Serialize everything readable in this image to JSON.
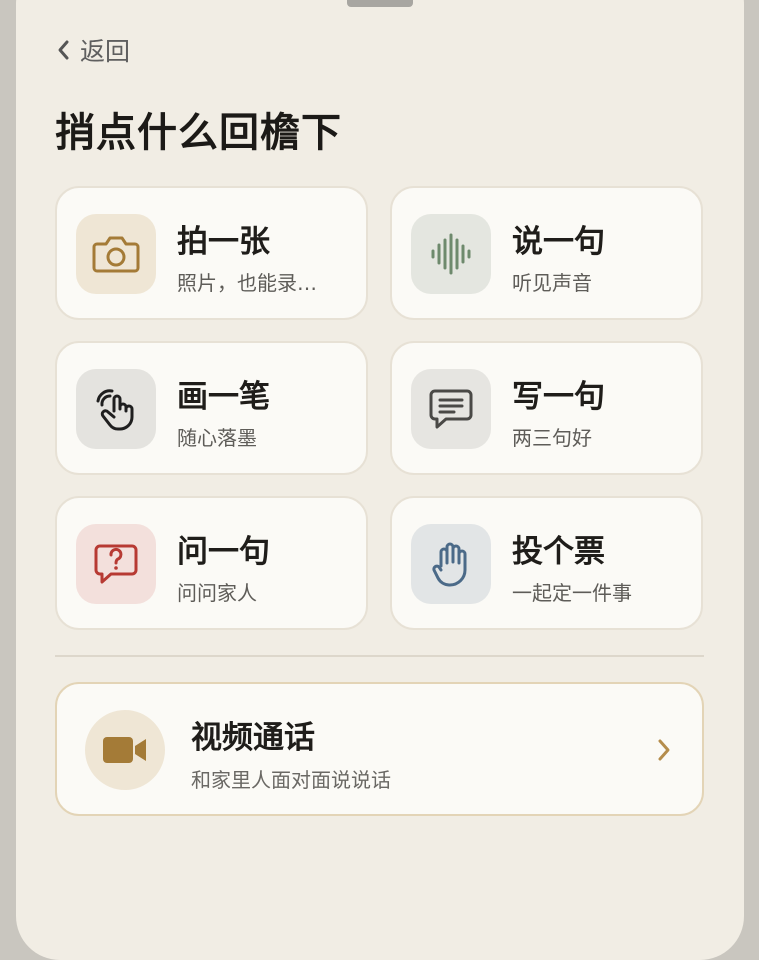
{
  "nav": {
    "back_label": "返回",
    "back_icon": "chevron-left-icon"
  },
  "page": {
    "title": "捎点什么回檐下"
  },
  "actions": [
    {
      "title": "拍一张",
      "subtitle": "照片，也能录…",
      "icon": "camera-icon",
      "icon_color": "#a47b37",
      "tile_color": "#efe6d5"
    },
    {
      "title": "说一句",
      "subtitle": "听见声音",
      "icon": "sound-wave-icon",
      "icon_color": "#6e8a6d",
      "tile_color": "#e4e6e0"
    },
    {
      "title": "画一笔",
      "subtitle": "随心落墨",
      "icon": "hand-draw-icon",
      "icon_color": "#1f1f1f",
      "tile_color": "#e4e3df"
    },
    {
      "title": "写一句",
      "subtitle": "两三句好",
      "icon": "message-icon",
      "icon_color": "#4a4946",
      "tile_color": "#e6e5e1"
    },
    {
      "title": "问一句",
      "subtitle": "问问家人",
      "icon": "question-bubble-icon",
      "icon_color": "#b73a33",
      "tile_color": "#f3e0dc"
    },
    {
      "title": "投个票",
      "subtitle": "一起定一件事",
      "icon": "raised-hand-icon",
      "icon_color": "#4b6a88",
      "tile_color": "#e2e5e6"
    }
  ],
  "video_call": {
    "title": "视频通话",
    "subtitle": "和家里人面对面说说话",
    "icon": "video-camera-icon",
    "icon_color": "#a47b37",
    "chevron_color": "#b58d4c"
  }
}
